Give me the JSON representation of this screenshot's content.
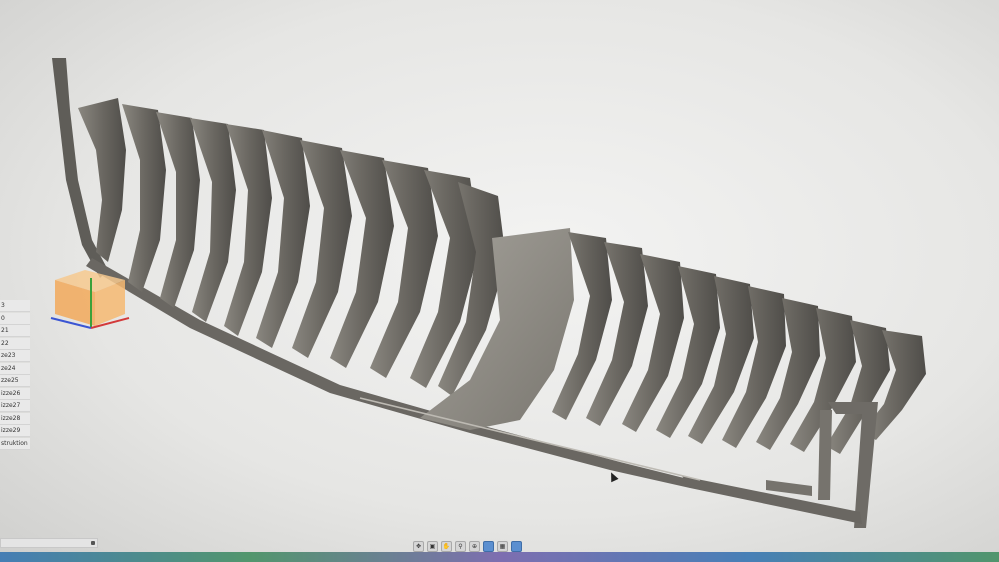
{
  "browser": {
    "items": [
      {
        "label": "3"
      },
      {
        "label": "0"
      },
      {
        "label": "21"
      },
      {
        "label": "22"
      },
      {
        "label": "ze23"
      },
      {
        "label": "ze24"
      },
      {
        "label": "zze25"
      },
      {
        "label": "izze26"
      },
      {
        "label": "izze27"
      },
      {
        "label": "izze28"
      },
      {
        "label": "izze29"
      },
      {
        "label": "struktion"
      }
    ]
  },
  "view_cube": {
    "icon": "view-cube-icon",
    "accent": "#f2a95a"
  },
  "model": {
    "material_color": "#6e6b66",
    "rib_count": 22
  },
  "nav_toolbar": {
    "tools": [
      "orbit-icon",
      "look-at-icon",
      "pan-icon",
      "zoom-icon",
      "fit-icon",
      "display-settings-icon",
      "grid-icon",
      "viewports-icon"
    ]
  }
}
